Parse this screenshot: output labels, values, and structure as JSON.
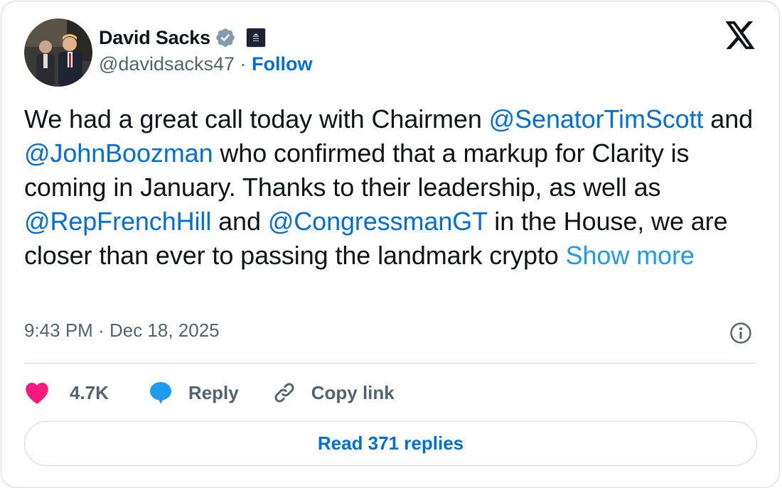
{
  "author": {
    "name": "David Sacks",
    "handle": "@davidsacks47",
    "separator": "·",
    "follow_label": "Follow",
    "affiliation_badge_text": "THE WHITE HOUSE"
  },
  "tweet": {
    "parts": [
      {
        "t": "We had a great call today with Chairmen "
      },
      {
        "m": "@SenatorTimScott"
      },
      {
        "t": " and "
      },
      {
        "m": "@JohnBoozman"
      },
      {
        "t": " who confirmed that a markup for Clarity is coming in January. Thanks to their leadership, as well as "
      },
      {
        "m": "@RepFrenchHill"
      },
      {
        "t": " and "
      },
      {
        "m": "@CongressmanGT"
      },
      {
        "t": " in the House, we are closer than ever to passing the landmark crypto "
      }
    ],
    "show_more": "Show more"
  },
  "meta": {
    "time": "9:43 PM",
    "separator": "·",
    "date": "Dec 18, 2025"
  },
  "actions": {
    "likes": "4.7K",
    "reply": "Reply",
    "copy_link": "Copy link"
  },
  "read_replies": "Read 371 replies",
  "icons": {
    "verified": "verified-badge-icon",
    "affiliation": "white-house-badge-icon",
    "brand": "x-logo-icon",
    "info": "info-icon",
    "like": "heart-icon",
    "reply": "reply-bubble-icon",
    "link": "link-icon"
  },
  "colors": {
    "link": "#006fd6",
    "show_more": "#1d9bf0",
    "like": "#f91880",
    "reply_icon": "#1d9bf0",
    "secondary_text": "#536471",
    "border": "#cfd9de"
  }
}
